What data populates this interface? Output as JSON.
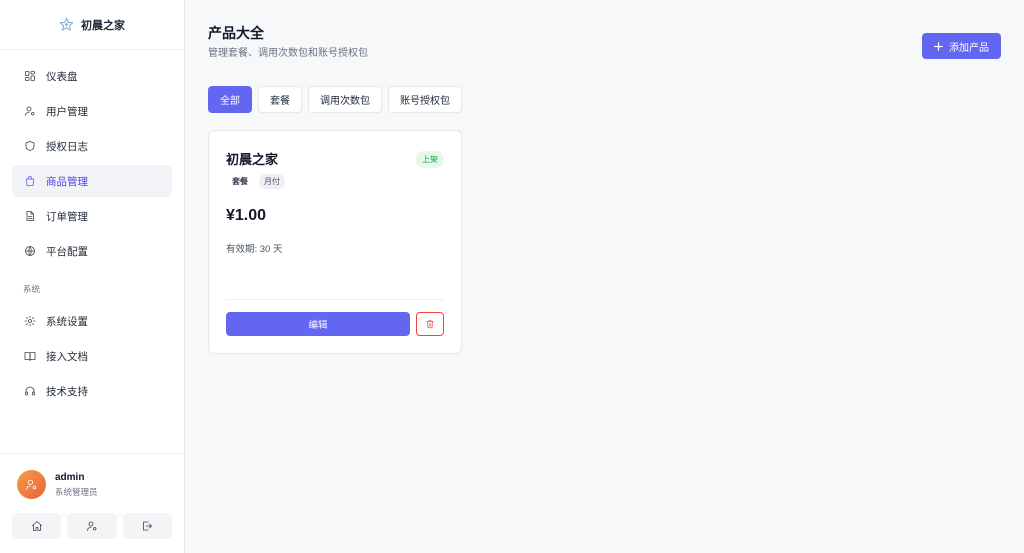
{
  "brand": {
    "name": "初晨之家"
  },
  "sidebar": {
    "items": [
      {
        "label": "仪表盘",
        "icon": "dashboard-icon"
      },
      {
        "label": "用户管理",
        "icon": "user-manage-icon"
      },
      {
        "label": "授权日志",
        "icon": "shield-icon"
      },
      {
        "label": "商品管理",
        "icon": "shopping-bag-icon",
        "active": true
      },
      {
        "label": "订单管理",
        "icon": "document-icon"
      },
      {
        "label": "平台配置",
        "icon": "globe-icon"
      }
    ],
    "section_label": "系统",
    "system_items": [
      {
        "label": "系统设置",
        "icon": "gear-icon"
      },
      {
        "label": "接入文档",
        "icon": "book-icon"
      },
      {
        "label": "技术支持",
        "icon": "headset-icon"
      }
    ]
  },
  "user": {
    "name": "admin",
    "role": "系统管理员"
  },
  "page": {
    "title": "产品大全",
    "subtitle": "管理套餐、调用次数包和账号授权包",
    "add_button": "添加产品"
  },
  "tabs": [
    {
      "label": "全部",
      "active": true
    },
    {
      "label": "套餐"
    },
    {
      "label": "调用次数包"
    },
    {
      "label": "账号授权包"
    }
  ],
  "product_card": {
    "title": "初晨之家",
    "status": "上架",
    "tags": [
      "套餐",
      "月付"
    ],
    "price": "¥1.00",
    "validity": "有效期: 30 天",
    "edit_label": "编辑"
  },
  "colors": {
    "accent": "#6366f1",
    "danger": "#ef4444",
    "success": "#16a34a"
  }
}
